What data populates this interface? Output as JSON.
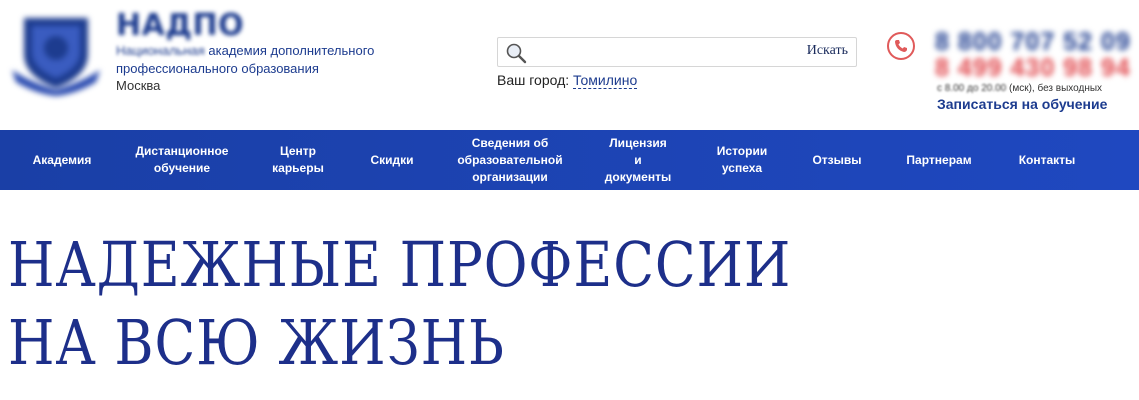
{
  "header": {
    "brand_name": "НАДПО",
    "brand_desc_line1_blur": "Национальная",
    "brand_desc_line1_rest": " академия дополнительного",
    "brand_desc_line2": "профессионального образования",
    "brand_city": "Москва"
  },
  "search": {
    "placeholder": "",
    "button_label": "Искать"
  },
  "city": {
    "label": "Ваш город:",
    "value": "Томилино"
  },
  "contact": {
    "phone1": "8 800 707 52 09",
    "phone2": "8 499 430 98 94",
    "hours_prefix": "с 8.00 до 20.00",
    "hours_suffix": " (мск), без выходных",
    "enroll_label": "Записаться на обучение"
  },
  "nav": {
    "items": [
      {
        "label": "Академия"
      },
      {
        "label": "Дистанционное\nобучение"
      },
      {
        "label": "Центр\nкарьеры"
      },
      {
        "label": "Скидки"
      },
      {
        "label": "Сведения об\nобразовательной\nорганизации"
      },
      {
        "label": "Лицензия\nи\nдокументы"
      },
      {
        "label": "Истории\nуспеха"
      },
      {
        "label": "Отзывы"
      },
      {
        "label": "Партнерам"
      },
      {
        "label": "Контакты"
      }
    ]
  },
  "hero": {
    "line1": "НАДЕЖНЫЕ ПРОФЕССИИ",
    "line2": "НА ВСЮ ЖИЗНЬ"
  },
  "colors": {
    "brand": "#1d3c8f",
    "nav_bg": "#1f45b8",
    "phone_accent": "#e0464b",
    "hero_text": "#1d2f8a"
  }
}
